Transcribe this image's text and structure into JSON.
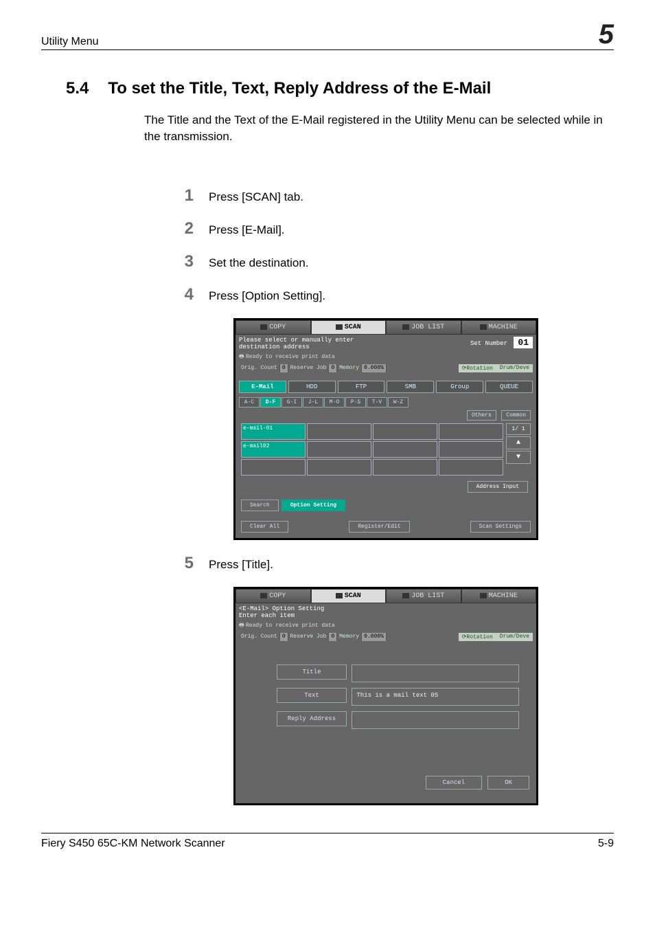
{
  "header": {
    "section": "Utility Menu",
    "chapter": "5"
  },
  "title": {
    "number": "5.4",
    "text": "To set the Title, Text, Reply Address of the E-Mail"
  },
  "intro": "The Title and the Text of the E-Mail registered in the Utility Menu can be selected while in the transmission.",
  "steps": [
    "Press [SCAN] tab.",
    "Press [E-Mail].",
    "Set the destination.",
    "Press [Option Setting].",
    "Press [Title]."
  ],
  "screenshot1": {
    "tabs": {
      "copy": "COPY",
      "scan": "SCAN",
      "joblist": "JOB LIST",
      "machine": "MACHINE"
    },
    "header_msg": "Please select or manually enter\ndestination address",
    "set_number_label": "Set Number",
    "set_number_value": "01",
    "ready": "Ready to receive print data",
    "status": {
      "orig_label": "Orig. Count",
      "orig_val": "0",
      "reserve": "Reserve Job",
      "reserve_val": "0",
      "memory": "Memory",
      "memory_val": "0.000%",
      "rotation": "Rotation",
      "drum": "Drum/Deve"
    },
    "main_tabs": [
      "E-Mail",
      "HDD",
      "FTP",
      "SMB",
      "Group",
      "QUEUE"
    ],
    "alpha_tabs": [
      "A-C",
      "D-F",
      "G-I",
      "J-L",
      "M-O",
      "P-S",
      "T-V",
      "W-Z"
    ],
    "others": "Others",
    "common": "Common",
    "dest1": "e-mail-01",
    "dest2": "e-mail02",
    "page_indicator": "1/  1",
    "address_input": "Address Input",
    "search": "Search",
    "option_setting": "Option Setting",
    "clear_all": "Clear All",
    "register_edit": "Register/Edit",
    "scan_settings": "Scan Settings"
  },
  "screenshot2": {
    "header_msg": "<E-Mail> Option Setting\nEnter each item",
    "title_btn": "Title",
    "text_btn": "Text",
    "text_value": "This is a mail text 05",
    "reply_btn": "Reply Address",
    "cancel": "Cancel",
    "ok": "OK"
  },
  "footer": {
    "product": "Fiery S450 65C-KM Network Scanner",
    "page": "5-9"
  }
}
